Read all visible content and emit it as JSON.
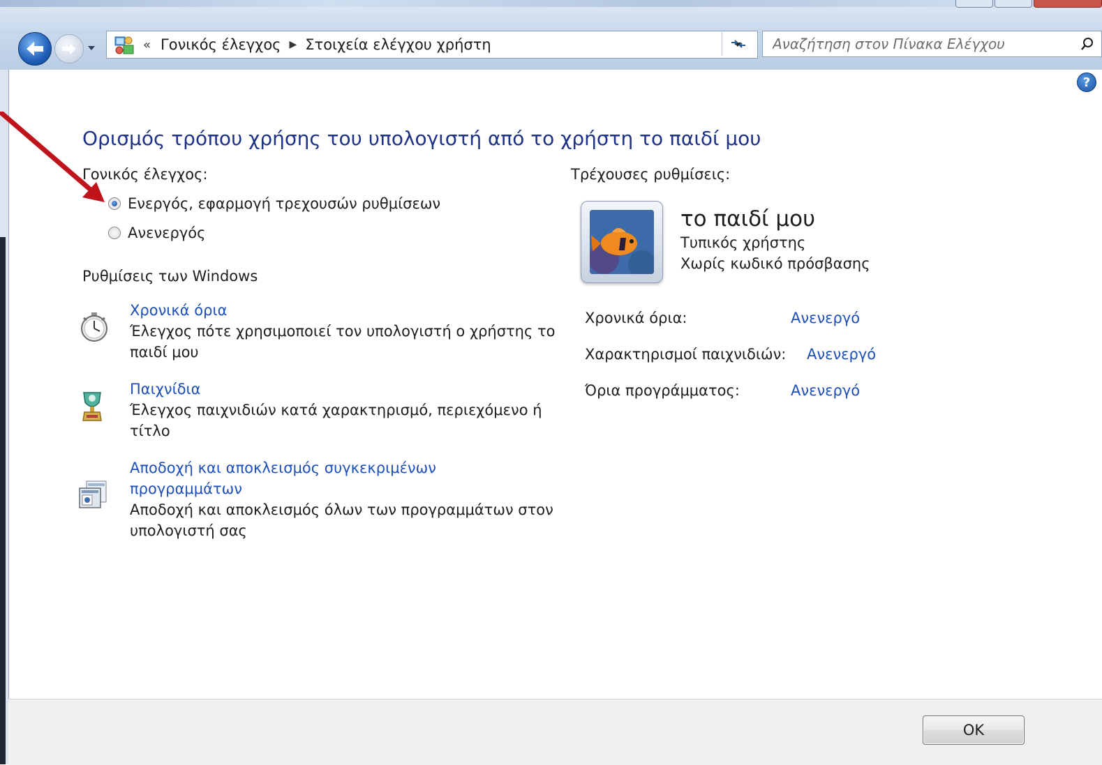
{
  "address_bar": {
    "overflow_chevron": "«",
    "crumbs": [
      "Γονικός έλεγχος",
      "Στοιχεία ελέγχου χρήστη"
    ]
  },
  "search": {
    "placeholder": "Αναζήτηση στον Πίνακα Ελέγχου"
  },
  "page": {
    "title": "Ορισμός τρόπου χρήσης του υπολογιστή από το χρήστη το παιδί μου",
    "parental_label": "Γονικός έλεγχος:",
    "radio_on": "Ενεργός, εφαρμογή τρεχουσών ρυθμίσεων",
    "radio_off": "Ανενεργός",
    "windows_settings_label": "Ρυθμίσεις των Windows",
    "selected_radio": "on"
  },
  "settings": [
    {
      "link": "Χρονικά όρια",
      "desc": "Έλεγχος πότε χρησιμοποιεί τον υπολογιστή ο χρήστης το παιδί μου",
      "icon": "stopwatch-icon"
    },
    {
      "link": "Παιχνίδια",
      "desc": "Έλεγχος παιχνιδιών κατά χαρακτηρισμό, περιεχόμενο ή τίτλο",
      "icon": "trophy-icon"
    },
    {
      "link": "Αποδοχή και αποκλεισμός συγκεκριμένων προγραμμάτων",
      "desc": "Αποδοχή και αποκλεισμός όλων των προγραμμάτων στον υπολογιστή σας",
      "icon": "program-window-icon"
    }
  ],
  "current": {
    "label": "Τρέχουσες ρυθμίσεις:",
    "user_name": "το παιδί μου",
    "user_type": "Τυπικός χρήστης",
    "password_status": "Χωρίς κωδικό πρόσβασης",
    "rows": [
      {
        "label": "Χρονικά όρια:",
        "value": "Ανενεργό"
      },
      {
        "label": "Χαρακτηρισμοί παιχνιδιών:",
        "value": "Ανενεργό"
      },
      {
        "label": "Όρια προγράμματος:",
        "value": "Ανενεργό"
      }
    ]
  },
  "footer": {
    "ok_label": "OK"
  },
  "colors": {
    "title": "#1e3287",
    "link": "#1e4fb7",
    "annotation_arrow": "#c0141c"
  }
}
